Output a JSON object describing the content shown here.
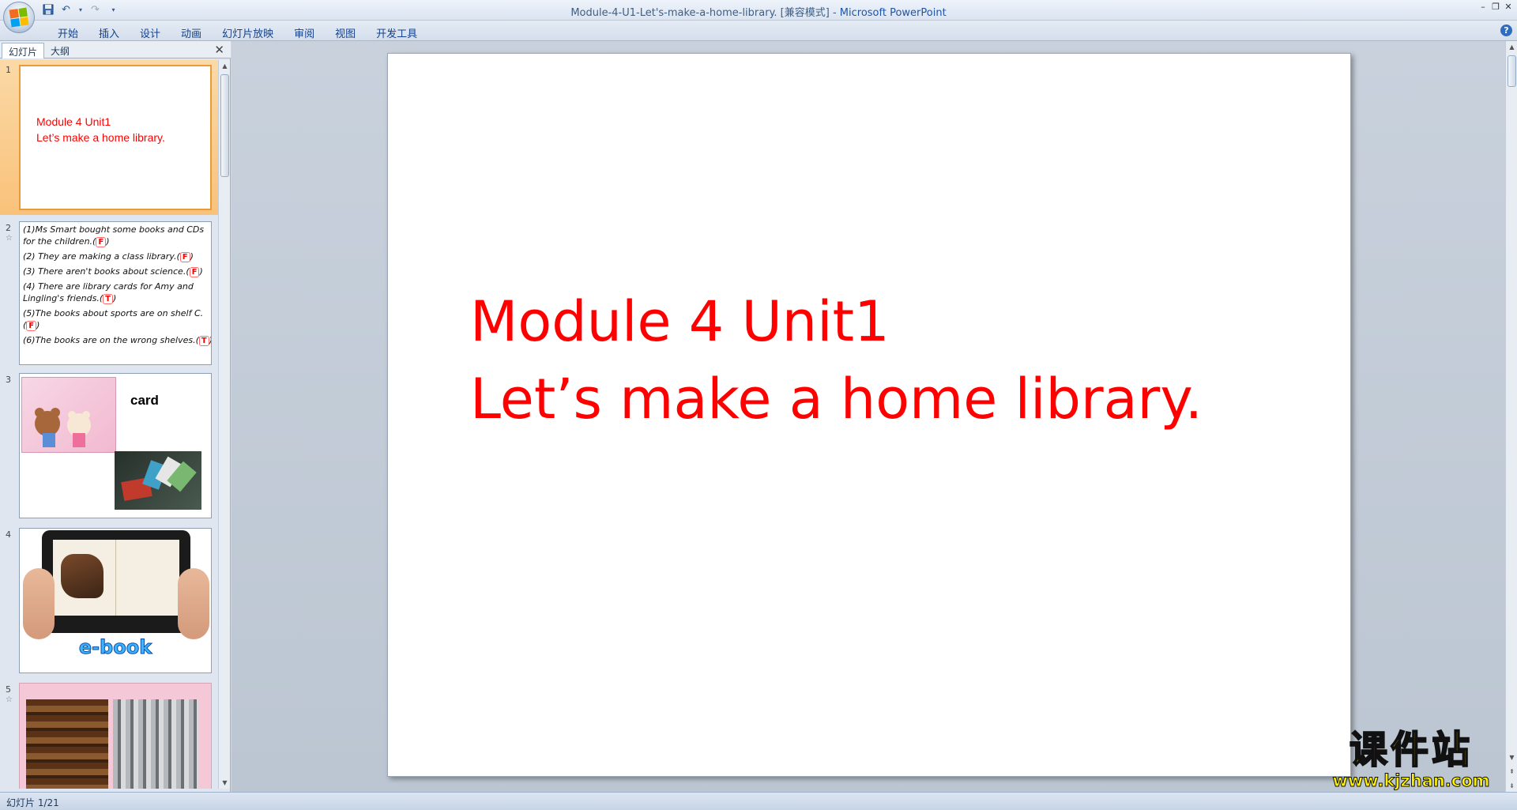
{
  "window": {
    "title_doc": "Module-4-U1-Let's-make-a-home-library. [兼容模式] - ",
    "title_app": "Microsoft PowerPoint"
  },
  "ribbon": {
    "tabs": [
      "开始",
      "插入",
      "设计",
      "动画",
      "幻灯片放映",
      "审阅",
      "视图",
      "开发工具"
    ]
  },
  "left_pane": {
    "tab_slides": "幻灯片",
    "tab_outline": "大纲",
    "close": "✕"
  },
  "thumbnails": [
    {
      "num": "1",
      "line1": "Module 4 Unit1",
      "line2": "Let’s make a home library."
    },
    {
      "num": "2",
      "items": [
        {
          "text": "(1)Ms Smart bought some books and CDs for the children.(",
          "answer": "F",
          "end": ")"
        },
        {
          "text": "(2) They are making a class library.(",
          "answer": "F",
          "end": ")"
        },
        {
          "text": "(3) There aren't books about science.(",
          "answer": "F",
          "end": ")"
        },
        {
          "text": "(4) There are library cards for Amy and Lingling's friends.(",
          "answer": "T",
          "end": ")"
        },
        {
          "text": "(5)The books about sports are on shelf C.(",
          "answer": "F",
          "end": ")"
        },
        {
          "text": "(6)The books are on the wrong shelves.(",
          "answer": "T",
          "end": ")"
        }
      ]
    },
    {
      "num": "3",
      "word": "card"
    },
    {
      "num": "4",
      "word": "e-book"
    },
    {
      "num": "5"
    }
  ],
  "slide": {
    "line1": "Module 4 Unit1",
    "line2": "Let’s make a home library."
  },
  "watermark": {
    "title": "课件站",
    "url": "www.kjzhan.com"
  },
  "status": {
    "slide_counter": "幻灯片 1/21"
  },
  "colors": {
    "slide_text": "#ff0000",
    "selected_thumb": "#f9c27a",
    "watermark": "#fff200"
  },
  "icons": [
    "office-button-icon",
    "save-icon",
    "undo-icon",
    "redo-icon",
    "customize-icon",
    "minimize-icon",
    "restore-icon",
    "close-icon",
    "help-icon"
  ]
}
